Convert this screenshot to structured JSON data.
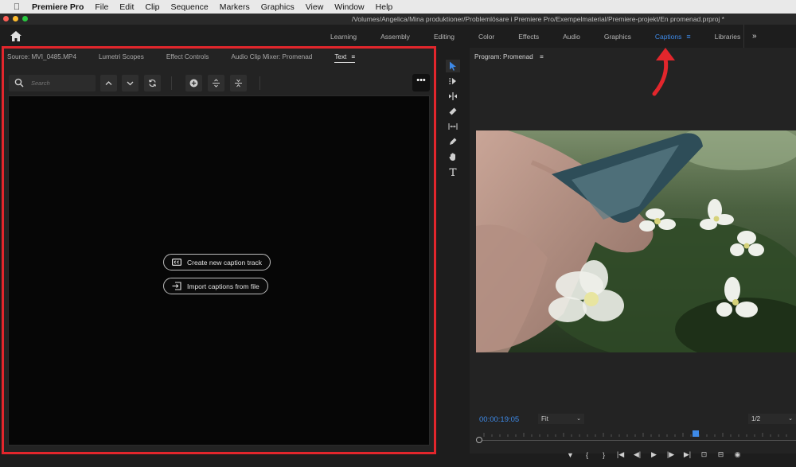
{
  "menubar": {
    "app": "Premiere Pro",
    "items": [
      "File",
      "Edit",
      "Clip",
      "Sequence",
      "Markers",
      "Graphics",
      "View",
      "Window",
      "Help"
    ]
  },
  "titlebar": {
    "path": "/Volumes/Angelica/Mina produktioner/Problemlösare i Premiere Pro/Exempelmaterial/Premiere-projekt/En promenad.prproj *"
  },
  "workspaces": {
    "tabs": [
      "Learning",
      "Assembly",
      "Editing",
      "Color",
      "Effects",
      "Audio",
      "Graphics",
      "Captions",
      "Libraries"
    ],
    "active": "Captions",
    "menu_glyph": "≡",
    "more_glyph": "»"
  },
  "left_panel": {
    "tabs": [
      "Source: MVI_0485.MP4",
      "Lumetri Scopes",
      "Effect Controls",
      "Audio Clip Mixer: Promenad",
      "Text"
    ],
    "active_tab": "Text",
    "tab_menu_glyph": "≡",
    "search_placeholder": "Search",
    "more_glyph": "•••",
    "create_button": "Create new caption track",
    "import_button": "Import captions from file"
  },
  "program": {
    "title": "Program: Promenad",
    "menu_glyph": "≡",
    "timecode": "00:00:19:05",
    "fit": "Fit",
    "resolution": "1/2"
  },
  "colors": {
    "accent": "#3e8ae8",
    "highlight_red": "#e2262c"
  }
}
